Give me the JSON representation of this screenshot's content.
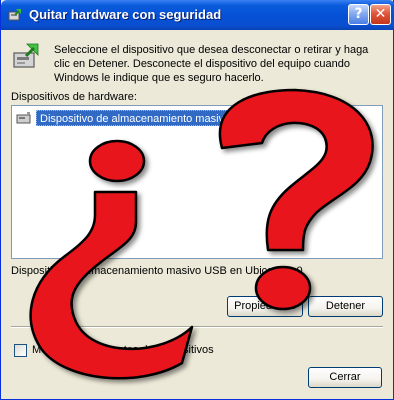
{
  "window": {
    "title": "Quitar hardware con seguridad",
    "help_glyph": "?",
    "close_glyph": "✕"
  },
  "intro_text": "Seleccione el dispositivo que desea desconectar o retirar y haga clic en Detener. Desconecte el dispositivo del equipo cuando Windows le indique que es seguro hacerlo.",
  "devices": {
    "label": "Dispositivos de hardware:",
    "items": [
      {
        "label": "Dispositivo de almacenamiento masivo USB",
        "selected": true,
        "icon": "usb-device-icon"
      }
    ]
  },
  "status_text": "Dispositivo de almacenamiento masivo USB en Ubicación 0",
  "buttons": {
    "properties": "Propiedades",
    "stop": "Detener",
    "close": "Cerrar"
  },
  "show_components": {
    "label": "Mostrar componentes de dispositivos",
    "checked": false
  },
  "overlay": {
    "description_icon": "question-marks-icon",
    "color": "#e8141b"
  },
  "colors": {
    "titlebar": "#0550d6",
    "selection": "#316ac5",
    "dialog_bg": "#ece9d8"
  }
}
